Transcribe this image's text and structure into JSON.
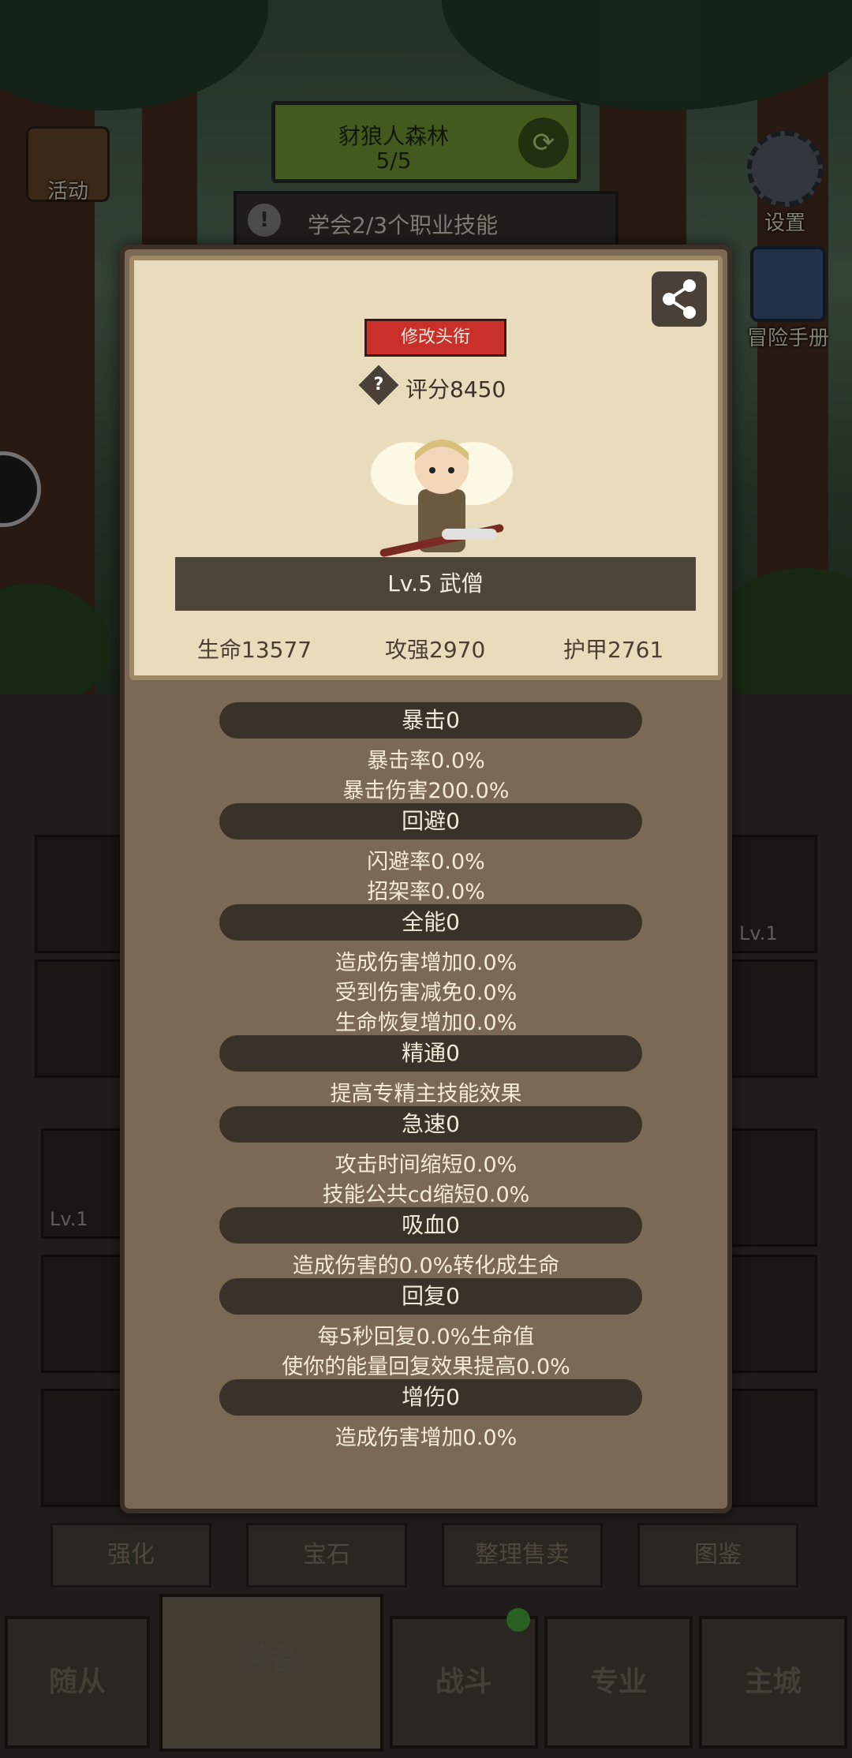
{
  "hud": {
    "stage_name": "豺狼人森林",
    "stage_progress": "5/5",
    "quest_text": "学会2/3个职业技能",
    "activity_label": "活动",
    "settings_label": "设置",
    "handbook_label": "冒险手册"
  },
  "profile": {
    "edit_title_label": "修改头衔",
    "score": "评分8450",
    "level_class": "Lv.5 武僧",
    "hp": "生命13577",
    "attack": "攻强2970",
    "armor": "护甲2761"
  },
  "stats": [
    {
      "header": "暴击0",
      "lines": [
        "暴击率0.0%",
        "暴击伤害200.0%"
      ]
    },
    {
      "header": "回避0",
      "lines": [
        "闪避率0.0%",
        "招架率0.0%"
      ]
    },
    {
      "header": "全能0",
      "lines": [
        "造成伤害增加0.0%",
        "受到伤害减免0.0%",
        "生命恢复增加0.0%"
      ]
    },
    {
      "header": "精通0",
      "lines": [
        "提高专精主技能效果"
      ]
    },
    {
      "header": "急速0",
      "lines": [
        "攻击时间缩短0.0%",
        "技能公共cd缩短0.0%"
      ]
    },
    {
      "header": "吸血0",
      "lines": [
        "造成伤害的0.0%转化成生命"
      ]
    },
    {
      "header": "回复0",
      "lines": [
        "每5秒回复0.0%生命值",
        "使你的能量回复效果提高0.0%"
      ]
    },
    {
      "header": "增伤0",
      "lines": [
        "造成伤害增加0.0%"
      ]
    }
  ],
  "lower": {
    "buttons": [
      "强化",
      "宝石",
      "整理售卖",
      "图鉴"
    ],
    "slot_level_left": "Lv.1",
    "slot_level_right": "Lv.1"
  },
  "tabs": [
    "随从",
    "装备",
    "战斗",
    "专业",
    "主城"
  ]
}
